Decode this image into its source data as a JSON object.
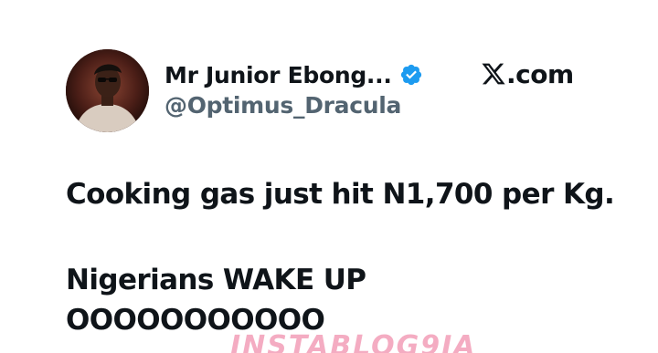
{
  "post": {
    "author": {
      "display_name": "Mr Junior Ebong...",
      "handle": "@Optimus_Dracula",
      "verified": true,
      "verified_icon": "verified-badge-icon",
      "verified_color": "#1d9bf0"
    },
    "source": {
      "logo_icon": "x-logo-icon",
      "label": ".com"
    },
    "text_lines": [
      "Cooking gas just hit N1,700 per Kg.",
      "Nigerians WAKE UP",
      "OOOOOOOOOOO"
    ]
  },
  "watermark": "INSTABLOG9JA"
}
